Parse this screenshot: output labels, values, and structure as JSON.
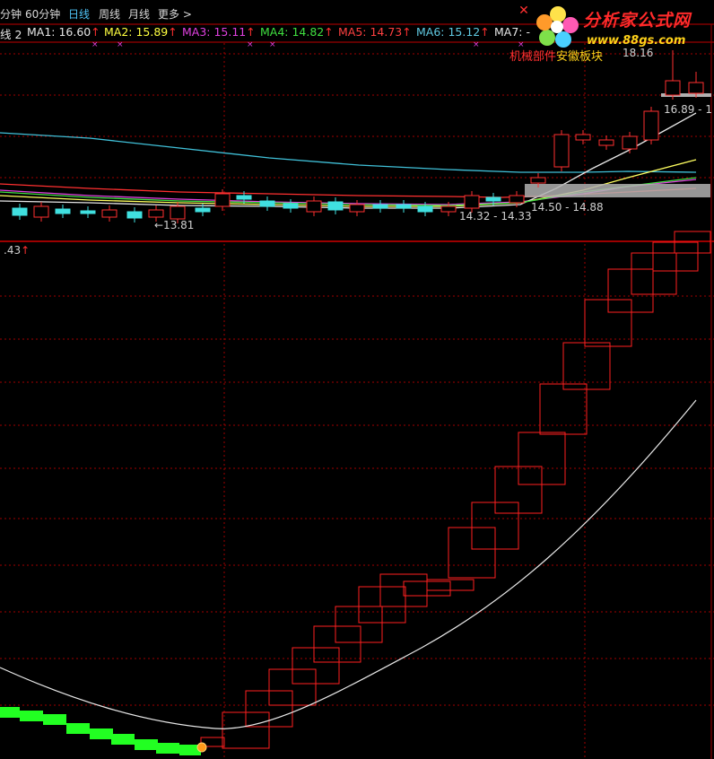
{
  "toolbar": {
    "tabs": [
      "分钟",
      "60分钟",
      "日线",
      "周线",
      "月线",
      "更多 >"
    ],
    "active_tab": "日线"
  },
  "ma_bar": {
    "prefix": "线 2",
    "items": [
      {
        "label": "MA1: 16.60",
        "color": "#e6e6e6"
      },
      {
        "label": "MA2: 15.89",
        "color": "#ffff40"
      },
      {
        "label": "MA3: 15.11",
        "color": "#e040e0"
      },
      {
        "label": "MA4: 14.82",
        "color": "#40e040"
      },
      {
        "label": "MA5: 14.73",
        "color": "#ff4040"
      },
      {
        "label": "MA6: 15.12",
        "color": "#60c8e0"
      },
      {
        "label": "MA7: -",
        "color": "#e6e6e6"
      }
    ],
    "arrow": "↑"
  },
  "logo": {
    "title": "分析家公式网",
    "url": "www.88gs.com"
  },
  "sector": {
    "part1": "机械部件",
    "part2": "安徽板块",
    "color1": "#ff3030",
    "color2": "#ffd21a"
  },
  "price_labels": {
    "high_top": "18.16",
    "high_range": "16.89 - 1",
    "low_left": "←13.81",
    "range_a": "14.32 - 14.33",
    "range_b": "14.50 - 14.88",
    "sub_scale": ".43"
  },
  "colors": {
    "background": "#000000",
    "grid": "#a00000",
    "up_candle": "#ff3030",
    "down_candle": "#40e0e0",
    "brick": "#ff2020",
    "green_bar": "#22ff22"
  }
}
